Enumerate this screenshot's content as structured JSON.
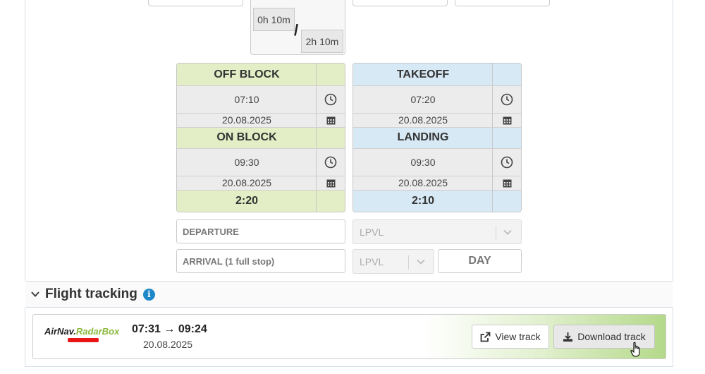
{
  "durations": {
    "first": "0h 10m",
    "separator": "/",
    "second": "2h 10m"
  },
  "blocks": {
    "off_block": {
      "title": "OFF BLOCK",
      "time": "07:10",
      "date": "20.08.2025"
    },
    "on_block": {
      "title": "ON BLOCK",
      "time": "09:30",
      "date": "20.08.2025",
      "total": "2:20"
    },
    "takeoff": {
      "title": "TAKEOFF",
      "time": "07:20",
      "date": "20.08.2025"
    },
    "landing": {
      "title": "LANDING",
      "time": "09:30",
      "date": "20.08.2025",
      "total": "2:10"
    }
  },
  "route": {
    "departure_label": "DEPARTURE",
    "departure_value": "LPVL",
    "arrival_label": "ARRIVAL (1 full stop)",
    "arrival_value": "LPVL",
    "day_button": "DAY"
  },
  "flight_tracking": {
    "title": "Flight tracking",
    "info_symbol": "i",
    "provider_logo": {
      "part1": "AirNav",
      "part2": ".",
      "part3": "RadarBox"
    },
    "times": "07:31 → 09:24",
    "date": "20.08.2025",
    "view_button": "View track",
    "download_button": "Download track"
  },
  "colors": {
    "block_green": "#e3eec6",
    "block_blue": "#d7e9f5",
    "info_blue": "#1e88c8",
    "track_gradient_end": "#b4d98a"
  }
}
